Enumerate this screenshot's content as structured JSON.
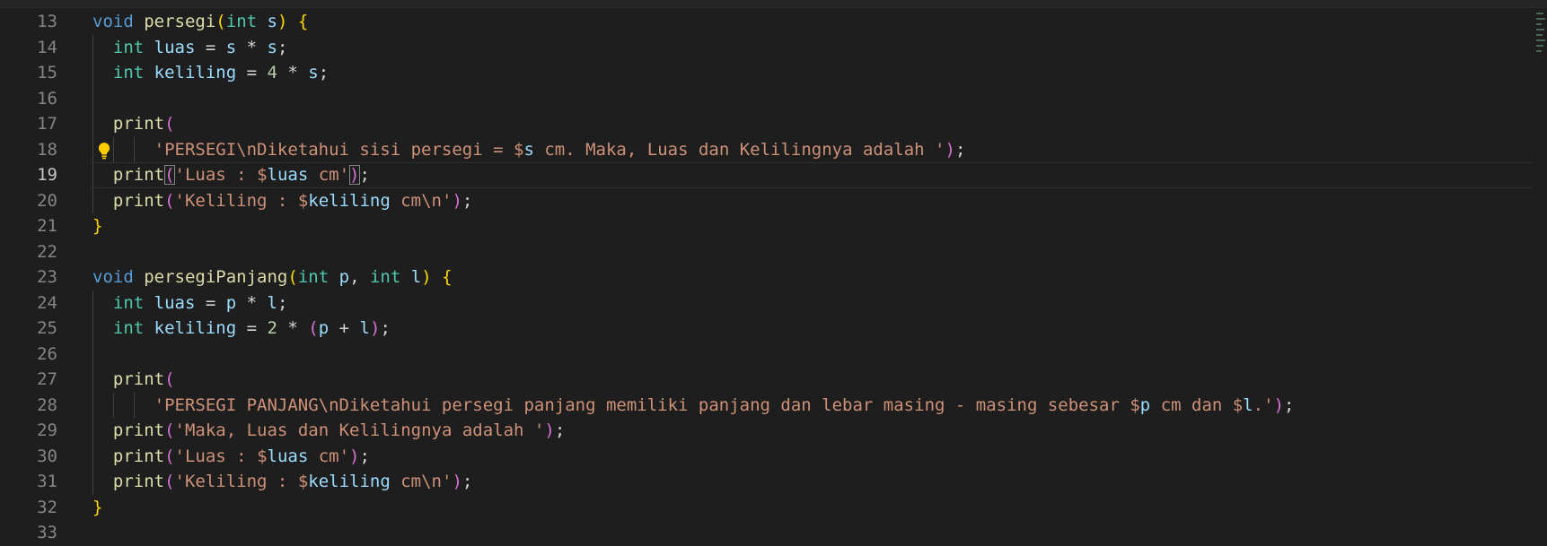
{
  "editor": {
    "lines": [
      {
        "n": "13",
        "tokens": [
          {
            "t": "void",
            "c": "kw"
          },
          {
            "t": " "
          },
          {
            "t": "persegi",
            "c": "fn"
          },
          {
            "t": "(",
            "c": "b1"
          },
          {
            "t": "int",
            "c": "ty"
          },
          {
            "t": " "
          },
          {
            "t": "s",
            "c": "vr"
          },
          {
            "t": ")",
            "c": "b1"
          },
          {
            "t": " "
          },
          {
            "t": "{",
            "c": "b1"
          }
        ]
      },
      {
        "n": "14",
        "guides": [
          1
        ],
        "tokens": [
          {
            "t": "  "
          },
          {
            "t": "int",
            "c": "ty"
          },
          {
            "t": " "
          },
          {
            "t": "luas",
            "c": "vr"
          },
          {
            "t": " = "
          },
          {
            "t": "s",
            "c": "vr"
          },
          {
            "t": " * "
          },
          {
            "t": "s",
            "c": "vr"
          },
          {
            "t": ";"
          }
        ]
      },
      {
        "n": "15",
        "guides": [
          1
        ],
        "tokens": [
          {
            "t": "  "
          },
          {
            "t": "int",
            "c": "ty"
          },
          {
            "t": " "
          },
          {
            "t": "keliling",
            "c": "vr"
          },
          {
            "t": " = "
          },
          {
            "t": "4",
            "c": "nm"
          },
          {
            "t": " * "
          },
          {
            "t": "s",
            "c": "vr"
          },
          {
            "t": ";"
          }
        ]
      },
      {
        "n": "16",
        "guides": [
          1
        ],
        "tokens": []
      },
      {
        "n": "17",
        "guides": [
          1
        ],
        "tokens": [
          {
            "t": "  "
          },
          {
            "t": "print",
            "c": "fn"
          },
          {
            "t": "(",
            "c": "b2"
          }
        ]
      },
      {
        "n": "18",
        "guides": [
          1,
          2,
          3
        ],
        "bulb": true,
        "tokens": [
          {
            "t": "      "
          },
          {
            "t": "'PERSEGI\\nDiketahui sisi persegi = ",
            "c": "st"
          },
          {
            "t": "$",
            "c": "st"
          },
          {
            "t": "s",
            "c": "vr"
          },
          {
            "t": " cm. Maka, Luas dan Kelilingnya adalah '",
            "c": "st"
          },
          {
            "t": ")",
            "c": "b2"
          },
          {
            "t": ";"
          }
        ]
      },
      {
        "n": "19",
        "guides": [
          1
        ],
        "current": true,
        "tokens": [
          {
            "t": "  "
          },
          {
            "t": "print",
            "c": "fn"
          },
          {
            "t": "(",
            "c": "b2",
            "box": true
          },
          {
            "t": "'Luas : ",
            "c": "st"
          },
          {
            "t": "$",
            "c": "st"
          },
          {
            "t": "luas",
            "c": "vr"
          },
          {
            "t": " cm'",
            "c": "st"
          },
          {
            "t": ")",
            "c": "b2",
            "box": true
          },
          {
            "t": ";"
          }
        ]
      },
      {
        "n": "20",
        "guides": [
          1
        ],
        "tokens": [
          {
            "t": "  "
          },
          {
            "t": "print",
            "c": "fn"
          },
          {
            "t": "(",
            "c": "b2"
          },
          {
            "t": "'Keliling : ",
            "c": "st"
          },
          {
            "t": "$",
            "c": "st"
          },
          {
            "t": "keliling",
            "c": "vr"
          },
          {
            "t": " cm\\n'",
            "c": "st"
          },
          {
            "t": ")",
            "c": "b2"
          },
          {
            "t": ";"
          }
        ]
      },
      {
        "n": "21",
        "tokens": [
          {
            "t": "}",
            "c": "b1"
          }
        ]
      },
      {
        "n": "22",
        "tokens": []
      },
      {
        "n": "23",
        "tokens": [
          {
            "t": "void",
            "c": "kw"
          },
          {
            "t": " "
          },
          {
            "t": "persegiPanjang",
            "c": "fn"
          },
          {
            "t": "(",
            "c": "b1"
          },
          {
            "t": "int",
            "c": "ty"
          },
          {
            "t": " "
          },
          {
            "t": "p",
            "c": "vr"
          },
          {
            "t": ", "
          },
          {
            "t": "int",
            "c": "ty"
          },
          {
            "t": " "
          },
          {
            "t": "l",
            "c": "vr"
          },
          {
            "t": ")",
            "c": "b1"
          },
          {
            "t": " "
          },
          {
            "t": "{",
            "c": "b1"
          }
        ]
      },
      {
        "n": "24",
        "guides": [
          1
        ],
        "tokens": [
          {
            "t": "  "
          },
          {
            "t": "int",
            "c": "ty"
          },
          {
            "t": " "
          },
          {
            "t": "luas",
            "c": "vr"
          },
          {
            "t": " = "
          },
          {
            "t": "p",
            "c": "vr"
          },
          {
            "t": " * "
          },
          {
            "t": "l",
            "c": "vr"
          },
          {
            "t": ";"
          }
        ]
      },
      {
        "n": "25",
        "guides": [
          1
        ],
        "tokens": [
          {
            "t": "  "
          },
          {
            "t": "int",
            "c": "ty"
          },
          {
            "t": " "
          },
          {
            "t": "keliling",
            "c": "vr"
          },
          {
            "t": " = "
          },
          {
            "t": "2",
            "c": "nm"
          },
          {
            "t": " * "
          },
          {
            "t": "(",
            "c": "b2"
          },
          {
            "t": "p",
            "c": "vr"
          },
          {
            "t": " + "
          },
          {
            "t": "l",
            "c": "vr"
          },
          {
            "t": ")",
            "c": "b2"
          },
          {
            "t": ";"
          }
        ]
      },
      {
        "n": "26",
        "guides": [
          1
        ],
        "tokens": []
      },
      {
        "n": "27",
        "guides": [
          1
        ],
        "tokens": [
          {
            "t": "  "
          },
          {
            "t": "print",
            "c": "fn"
          },
          {
            "t": "(",
            "c": "b2"
          }
        ]
      },
      {
        "n": "28",
        "guides": [
          1,
          2,
          3
        ],
        "tokens": [
          {
            "t": "      "
          },
          {
            "t": "'PERSEGI PANJANG\\nDiketahui persegi panjang memiliki panjang dan lebar masing - masing sebesar ",
            "c": "st"
          },
          {
            "t": "$",
            "c": "st"
          },
          {
            "t": "p",
            "c": "vr"
          },
          {
            "t": " cm dan ",
            "c": "st"
          },
          {
            "t": "$",
            "c": "st"
          },
          {
            "t": "l",
            "c": "vr"
          },
          {
            "t": ".'",
            "c": "st"
          },
          {
            "t": ")",
            "c": "b2"
          },
          {
            "t": ";"
          }
        ]
      },
      {
        "n": "29",
        "guides": [
          1
        ],
        "tokens": [
          {
            "t": "  "
          },
          {
            "t": "print",
            "c": "fn"
          },
          {
            "t": "(",
            "c": "b2"
          },
          {
            "t": "'Maka, Luas dan Kelilingnya adalah '",
            "c": "st"
          },
          {
            "t": ")",
            "c": "b2"
          },
          {
            "t": ";"
          }
        ]
      },
      {
        "n": "30",
        "guides": [
          1
        ],
        "tokens": [
          {
            "t": "  "
          },
          {
            "t": "print",
            "c": "fn"
          },
          {
            "t": "(",
            "c": "b2"
          },
          {
            "t": "'Luas : ",
            "c": "st"
          },
          {
            "t": "$",
            "c": "st"
          },
          {
            "t": "luas",
            "c": "vr"
          },
          {
            "t": " cm'",
            "c": "st"
          },
          {
            "t": ")",
            "c": "b2"
          },
          {
            "t": ";"
          }
        ]
      },
      {
        "n": "31",
        "guides": [
          1
        ],
        "tokens": [
          {
            "t": "  "
          },
          {
            "t": "print",
            "c": "fn"
          },
          {
            "t": "(",
            "c": "b2"
          },
          {
            "t": "'Keliling : ",
            "c": "st"
          },
          {
            "t": "$",
            "c": "st"
          },
          {
            "t": "keliling",
            "c": "vr"
          },
          {
            "t": " cm\\n'",
            "c": "st"
          },
          {
            "t": ")",
            "c": "b2"
          },
          {
            "t": ";"
          }
        ]
      },
      {
        "n": "32",
        "tokens": [
          {
            "t": "}",
            "c": "b1"
          }
        ]
      },
      {
        "n": "33",
        "tokens": []
      }
    ]
  },
  "theme": {
    "background": "#1e1e1e",
    "keyword": "#569cd6",
    "type": "#4ec9b0",
    "function": "#dcdcaa",
    "variable": "#9cdcfe",
    "string": "#ce9178",
    "number": "#b5cea8",
    "bracket_level1": "#ffd700",
    "bracket_level2": "#da70d6",
    "lightbulb": "#ffcc00"
  },
  "icons": {
    "code_action": "lightbulb-icon"
  }
}
